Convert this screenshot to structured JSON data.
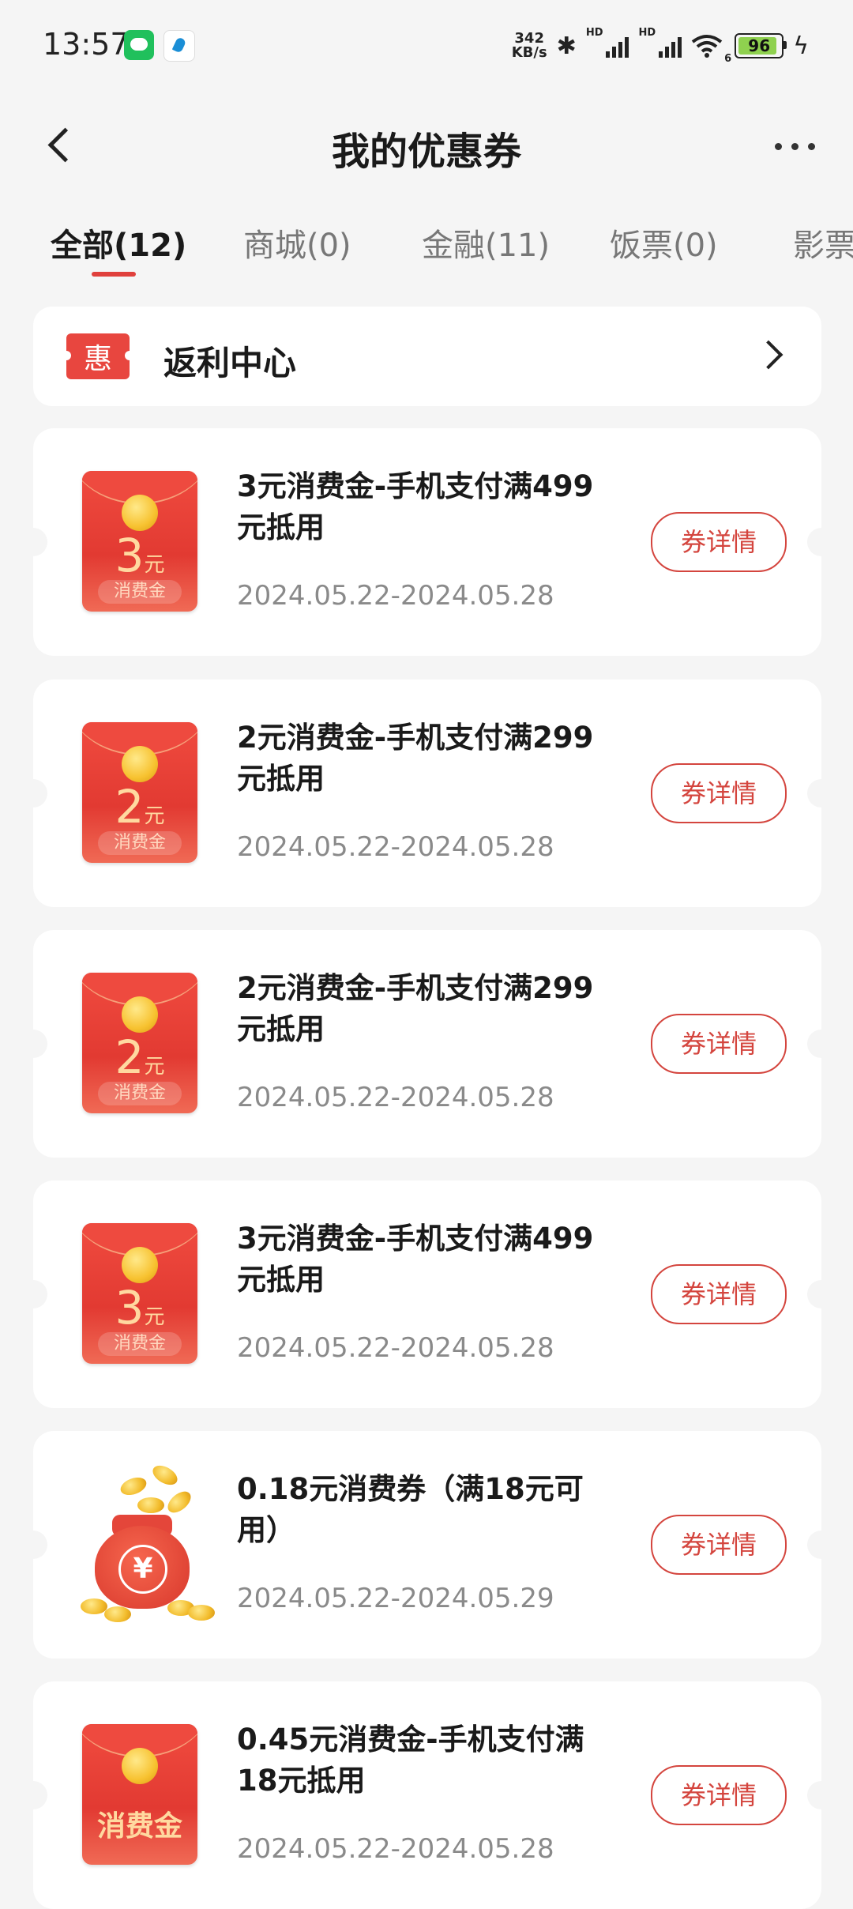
{
  "status_bar": {
    "time": "13:57",
    "net_speed_value": "342",
    "net_speed_unit": "KB/s",
    "signal1_label": "HD",
    "signal2_label": "HD",
    "wifi_suffix": "6",
    "battery": "96",
    "icons": [
      "wechat-icon",
      "app-leaf-icon",
      "bluetooth-icon",
      "signal-icon",
      "wifi-icon",
      "battery-icon",
      "charging-icon"
    ]
  },
  "header": {
    "title": "我的优惠券"
  },
  "tabs": [
    {
      "label": "全部(12)",
      "active": true
    },
    {
      "label": "商城(0)",
      "active": false
    },
    {
      "label": "金融(11)",
      "active": false
    },
    {
      "label": "饭票(0)",
      "active": false
    },
    {
      "label": "影票",
      "active": false
    }
  ],
  "rebate": {
    "badge": "惠",
    "label": "返利中心"
  },
  "coupons": [
    {
      "type": "envelope",
      "amount": "3",
      "unit": "元",
      "tag": "消费金",
      "title": "3元消费金-手机支付满499元抵用",
      "date": "2024.05.22-2024.05.28",
      "button": "券详情"
    },
    {
      "type": "envelope",
      "amount": "2",
      "unit": "元",
      "tag": "消费金",
      "title": "2元消费金-手机支付满299元抵用",
      "date": "2024.05.22-2024.05.28",
      "button": "券详情"
    },
    {
      "type": "envelope",
      "amount": "2",
      "unit": "元",
      "tag": "消费金",
      "title": "2元消费金-手机支付满299元抵用",
      "date": "2024.05.22-2024.05.28",
      "button": "券详情"
    },
    {
      "type": "envelope",
      "amount": "3",
      "unit": "元",
      "tag": "消费金",
      "title": "3元消费金-手机支付满499元抵用",
      "date": "2024.05.22-2024.05.28",
      "button": "券详情"
    },
    {
      "type": "bag",
      "symbol": "¥",
      "title": "0.18元消费券（满18元可用）",
      "date": "2024.05.22-2024.05.29",
      "button": "券详情"
    },
    {
      "type": "envelope-big",
      "big_text": "消费金",
      "title": "0.45元消费金-手机支付满18元抵用",
      "date": "2024.05.22-2024.05.28",
      "button": "券详情"
    }
  ],
  "colors": {
    "accent": "#e0403c",
    "background": "#f5f5f5",
    "card": "#ffffff",
    "date_text": "#8a8a8a"
  }
}
